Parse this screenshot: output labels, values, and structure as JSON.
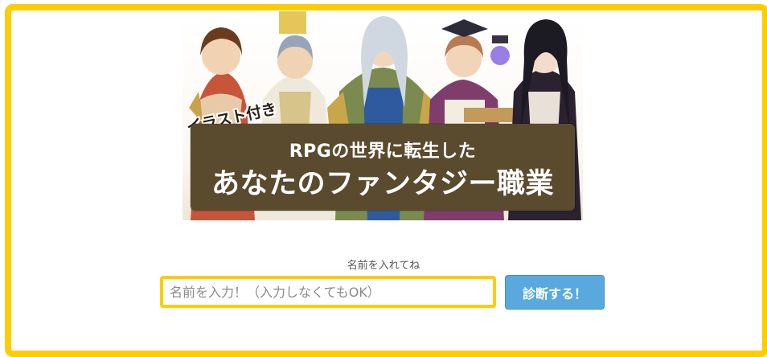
{
  "banner": {
    "tag": "イラスト付き",
    "title_line1": "RPGの世界に転生した",
    "title_line2": "あなたのファンタジー職業",
    "characters": [
      "warrior-girl",
      "priest",
      "elf-knight",
      "scholar-girl",
      "witch-with-lantern"
    ]
  },
  "form": {
    "label": "名前を入れてね",
    "input_value": "",
    "input_placeholder": "名前を入力！（入力しなくてもOK）",
    "button_label": "診断する！"
  },
  "colors": {
    "frame": "#ffcc00",
    "button": "#5aa9de",
    "title_box": "#5a4a2e"
  }
}
